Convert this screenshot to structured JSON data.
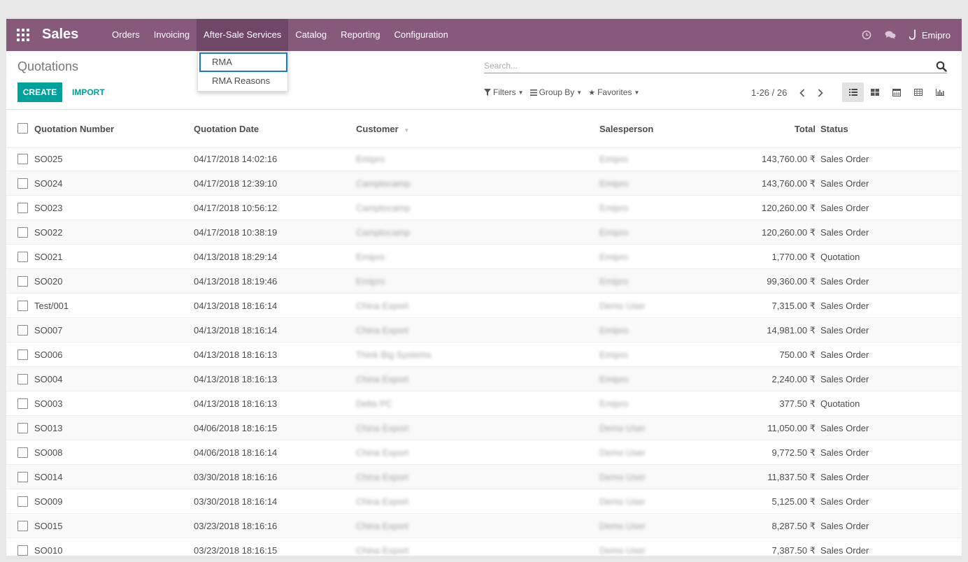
{
  "app": {
    "name": "Sales"
  },
  "nav": {
    "menus": [
      "Orders",
      "Invoicing",
      "After-Sale Services",
      "Catalog",
      "Reporting",
      "Configuration"
    ],
    "active_index": 2,
    "user": "Emipro"
  },
  "dropdown": {
    "items": [
      "RMA",
      "RMA Reasons"
    ],
    "highlighted": "RMA"
  },
  "control": {
    "title": "Quotations",
    "create_label": "CREATE",
    "import_label": "IMPORT",
    "search_placeholder": "Search...",
    "filters": [
      "Filters",
      "Group By",
      "Favorites"
    ],
    "pager": "1-26 / 26",
    "views": [
      "list-view-icon",
      "kanban-view-icon",
      "calendar-view-icon",
      "pivot-view-icon",
      "graph-view-icon"
    ]
  },
  "table": {
    "columns": [
      "Quotation Number",
      "Quotation Date",
      "Customer",
      "Salesperson",
      "Total",
      "Status"
    ],
    "rows": [
      {
        "number": "SO025",
        "date": "04/17/2018 14:02:16",
        "customer": "Emipro",
        "salesperson": "Emipro",
        "total": "143,760.00 ₹",
        "status": "Sales Order"
      },
      {
        "number": "SO024",
        "date": "04/17/2018 12:39:10",
        "customer": "Camptocamp",
        "salesperson": "Emipro",
        "total": "143,760.00 ₹",
        "status": "Sales Order"
      },
      {
        "number": "SO023",
        "date": "04/17/2018 10:56:12",
        "customer": "Camptocamp",
        "salesperson": "Emipro",
        "total": "120,260.00 ₹",
        "status": "Sales Order"
      },
      {
        "number": "SO022",
        "date": "04/17/2018 10:38:19",
        "customer": "Camptocamp",
        "salesperson": "Emipro",
        "total": "120,260.00 ₹",
        "status": "Sales Order"
      },
      {
        "number": "SO021",
        "date": "04/13/2018 18:29:14",
        "customer": "Emipro",
        "salesperson": "Emipro",
        "total": "1,770.00 ₹",
        "status": "Quotation"
      },
      {
        "number": "SO020",
        "date": "04/13/2018 18:19:46",
        "customer": "Emipro",
        "salesperson": "Emipro",
        "total": "99,360.00 ₹",
        "status": "Sales Order"
      },
      {
        "number": "Test/001",
        "date": "04/13/2018 18:16:14",
        "customer": "China Export",
        "salesperson": "Demo User",
        "total": "7,315.00 ₹",
        "status": "Sales Order"
      },
      {
        "number": "SO007",
        "date": "04/13/2018 18:16:14",
        "customer": "China Export",
        "salesperson": "Emipro",
        "total": "14,981.00 ₹",
        "status": "Sales Order"
      },
      {
        "number": "SO006",
        "date": "04/13/2018 18:16:13",
        "customer": "Think Big Systems",
        "salesperson": "Emipro",
        "total": "750.00 ₹",
        "status": "Sales Order"
      },
      {
        "number": "SO004",
        "date": "04/13/2018 18:16:13",
        "customer": "China Export",
        "salesperson": "Emipro",
        "total": "2,240.00 ₹",
        "status": "Sales Order"
      },
      {
        "number": "SO003",
        "date": "04/13/2018 18:16:13",
        "customer": "Delta PC",
        "salesperson": "Emipro",
        "total": "377.50 ₹",
        "status": "Quotation"
      },
      {
        "number": "SO013",
        "date": "04/06/2018 18:16:15",
        "customer": "China Export",
        "salesperson": "Demo User",
        "total": "11,050.00 ₹",
        "status": "Sales Order"
      },
      {
        "number": "SO008",
        "date": "04/06/2018 18:16:14",
        "customer": "China Export",
        "salesperson": "Demo User",
        "total": "9,772.50 ₹",
        "status": "Sales Order"
      },
      {
        "number": "SO014",
        "date": "03/30/2018 18:16:16",
        "customer": "China Export",
        "salesperson": "Demo User",
        "total": "11,837.50 ₹",
        "status": "Sales Order"
      },
      {
        "number": "SO009",
        "date": "03/30/2018 18:16:14",
        "customer": "China Export",
        "salesperson": "Demo User",
        "total": "5,125.00 ₹",
        "status": "Sales Order"
      },
      {
        "number": "SO015",
        "date": "03/23/2018 18:16:16",
        "customer": "China Export",
        "salesperson": "Demo User",
        "total": "8,287.50 ₹",
        "status": "Sales Order"
      },
      {
        "number": "SO010",
        "date": "03/23/2018 18:16:15",
        "customer": "China Export",
        "salesperson": "Demo User",
        "total": "7,387.50 ₹",
        "status": "Sales Order"
      }
    ]
  }
}
